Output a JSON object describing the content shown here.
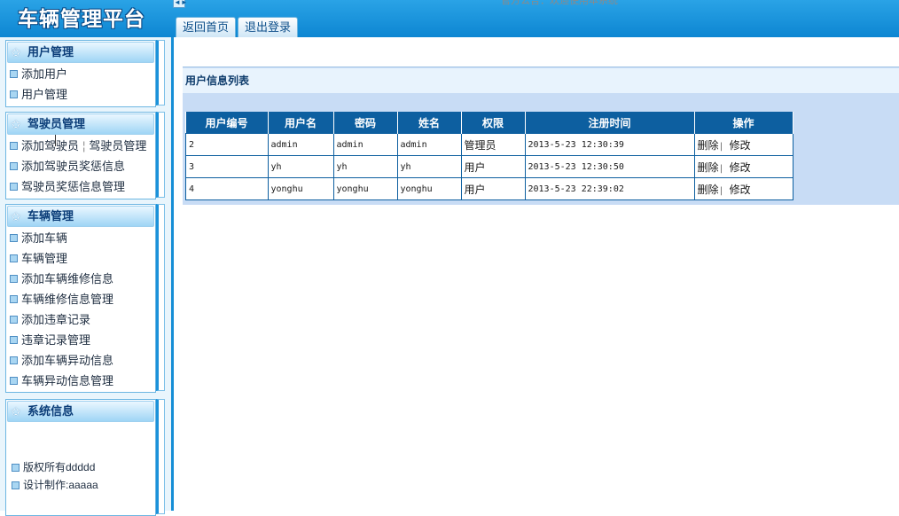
{
  "header": {
    "brand": "车辆管理平台",
    "notice": "官方公告：欢迎使用本系统",
    "tabs": [
      "返回首页",
      "退出登录"
    ]
  },
  "sidebar": {
    "user_mgmt": {
      "title": "用户管理",
      "items": [
        "添加用户",
        "用户管理"
      ]
    },
    "driver_mgmt": {
      "title": "驾驶员管理",
      "items": [
        "添加驾驶员",
        "驾驶员管理",
        "添加驾驶员奖惩信息",
        "驾驶员奖惩信息管理"
      ]
    },
    "vehicle_mgmt": {
      "title": "车辆管理",
      "items": [
        "添加车辆",
        "车辆管理",
        "添加车辆维修信息",
        "车辆维修信息管理",
        "添加违章记录",
        "违章记录管理",
        "添加车辆异动信息",
        "车辆异动信息管理"
      ]
    },
    "system_info": {
      "title": "系统信息",
      "copyright": "版权所有ddddd",
      "designer": "设计制作:aaaaa"
    }
  },
  "main": {
    "title": "用户信息列表",
    "columns": [
      "用户编号",
      "用户名",
      "密码",
      "姓名",
      "权限",
      "注册时间",
      "操作"
    ],
    "rows": [
      [
        "2",
        "admin",
        "admin",
        "admin",
        "管理员",
        "2013-5-23 12:30:39"
      ],
      [
        "3",
        "yh",
        "yh",
        "yh",
        "用户",
        "2013-5-23 12:30:50"
      ],
      [
        "4",
        "yonghu",
        "yonghu",
        "yonghu",
        "用户",
        "2013-5-23 22:39:02"
      ]
    ],
    "actions": {
      "delete": "删除",
      "edit": "修改"
    }
  }
}
